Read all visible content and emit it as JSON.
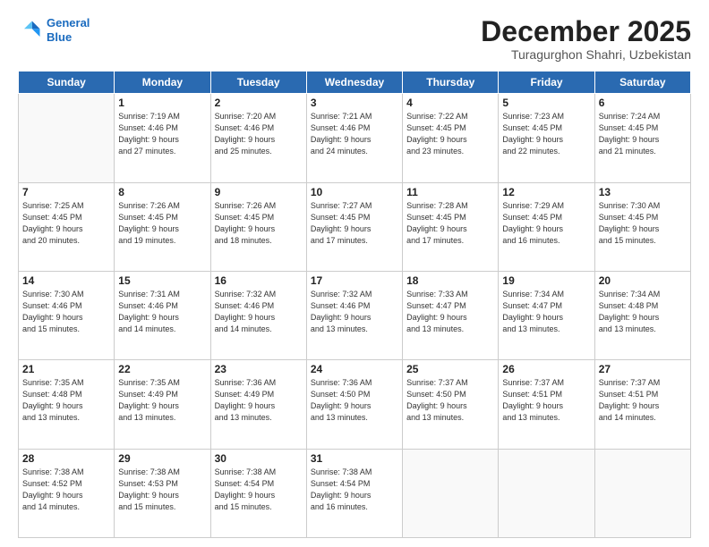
{
  "header": {
    "logo_line1": "General",
    "logo_line2": "Blue",
    "month": "December 2025",
    "location": "Turagurghon Shahri, Uzbekistan"
  },
  "weekdays": [
    "Sunday",
    "Monday",
    "Tuesday",
    "Wednesday",
    "Thursday",
    "Friday",
    "Saturday"
  ],
  "weeks": [
    [
      {
        "day": "",
        "info": ""
      },
      {
        "day": "1",
        "info": "Sunrise: 7:19 AM\nSunset: 4:46 PM\nDaylight: 9 hours\nand 27 minutes."
      },
      {
        "day": "2",
        "info": "Sunrise: 7:20 AM\nSunset: 4:46 PM\nDaylight: 9 hours\nand 25 minutes."
      },
      {
        "day": "3",
        "info": "Sunrise: 7:21 AM\nSunset: 4:46 PM\nDaylight: 9 hours\nand 24 minutes."
      },
      {
        "day": "4",
        "info": "Sunrise: 7:22 AM\nSunset: 4:45 PM\nDaylight: 9 hours\nand 23 minutes."
      },
      {
        "day": "5",
        "info": "Sunrise: 7:23 AM\nSunset: 4:45 PM\nDaylight: 9 hours\nand 22 minutes."
      },
      {
        "day": "6",
        "info": "Sunrise: 7:24 AM\nSunset: 4:45 PM\nDaylight: 9 hours\nand 21 minutes."
      }
    ],
    [
      {
        "day": "7",
        "info": "Sunrise: 7:25 AM\nSunset: 4:45 PM\nDaylight: 9 hours\nand 20 minutes."
      },
      {
        "day": "8",
        "info": "Sunrise: 7:26 AM\nSunset: 4:45 PM\nDaylight: 9 hours\nand 19 minutes."
      },
      {
        "day": "9",
        "info": "Sunrise: 7:26 AM\nSunset: 4:45 PM\nDaylight: 9 hours\nand 18 minutes."
      },
      {
        "day": "10",
        "info": "Sunrise: 7:27 AM\nSunset: 4:45 PM\nDaylight: 9 hours\nand 17 minutes."
      },
      {
        "day": "11",
        "info": "Sunrise: 7:28 AM\nSunset: 4:45 PM\nDaylight: 9 hours\nand 17 minutes."
      },
      {
        "day": "12",
        "info": "Sunrise: 7:29 AM\nSunset: 4:45 PM\nDaylight: 9 hours\nand 16 minutes."
      },
      {
        "day": "13",
        "info": "Sunrise: 7:30 AM\nSunset: 4:45 PM\nDaylight: 9 hours\nand 15 minutes."
      }
    ],
    [
      {
        "day": "14",
        "info": "Sunrise: 7:30 AM\nSunset: 4:46 PM\nDaylight: 9 hours\nand 15 minutes."
      },
      {
        "day": "15",
        "info": "Sunrise: 7:31 AM\nSunset: 4:46 PM\nDaylight: 9 hours\nand 14 minutes."
      },
      {
        "day": "16",
        "info": "Sunrise: 7:32 AM\nSunset: 4:46 PM\nDaylight: 9 hours\nand 14 minutes."
      },
      {
        "day": "17",
        "info": "Sunrise: 7:32 AM\nSunset: 4:46 PM\nDaylight: 9 hours\nand 13 minutes."
      },
      {
        "day": "18",
        "info": "Sunrise: 7:33 AM\nSunset: 4:47 PM\nDaylight: 9 hours\nand 13 minutes."
      },
      {
        "day": "19",
        "info": "Sunrise: 7:34 AM\nSunset: 4:47 PM\nDaylight: 9 hours\nand 13 minutes."
      },
      {
        "day": "20",
        "info": "Sunrise: 7:34 AM\nSunset: 4:48 PM\nDaylight: 9 hours\nand 13 minutes."
      }
    ],
    [
      {
        "day": "21",
        "info": "Sunrise: 7:35 AM\nSunset: 4:48 PM\nDaylight: 9 hours\nand 13 minutes."
      },
      {
        "day": "22",
        "info": "Sunrise: 7:35 AM\nSunset: 4:49 PM\nDaylight: 9 hours\nand 13 minutes."
      },
      {
        "day": "23",
        "info": "Sunrise: 7:36 AM\nSunset: 4:49 PM\nDaylight: 9 hours\nand 13 minutes."
      },
      {
        "day": "24",
        "info": "Sunrise: 7:36 AM\nSunset: 4:50 PM\nDaylight: 9 hours\nand 13 minutes."
      },
      {
        "day": "25",
        "info": "Sunrise: 7:37 AM\nSunset: 4:50 PM\nDaylight: 9 hours\nand 13 minutes."
      },
      {
        "day": "26",
        "info": "Sunrise: 7:37 AM\nSunset: 4:51 PM\nDaylight: 9 hours\nand 13 minutes."
      },
      {
        "day": "27",
        "info": "Sunrise: 7:37 AM\nSunset: 4:51 PM\nDaylight: 9 hours\nand 14 minutes."
      }
    ],
    [
      {
        "day": "28",
        "info": "Sunrise: 7:38 AM\nSunset: 4:52 PM\nDaylight: 9 hours\nand 14 minutes."
      },
      {
        "day": "29",
        "info": "Sunrise: 7:38 AM\nSunset: 4:53 PM\nDaylight: 9 hours\nand 15 minutes."
      },
      {
        "day": "30",
        "info": "Sunrise: 7:38 AM\nSunset: 4:54 PM\nDaylight: 9 hours\nand 15 minutes."
      },
      {
        "day": "31",
        "info": "Sunrise: 7:38 AM\nSunset: 4:54 PM\nDaylight: 9 hours\nand 16 minutes."
      },
      {
        "day": "",
        "info": ""
      },
      {
        "day": "",
        "info": ""
      },
      {
        "day": "",
        "info": ""
      }
    ]
  ]
}
